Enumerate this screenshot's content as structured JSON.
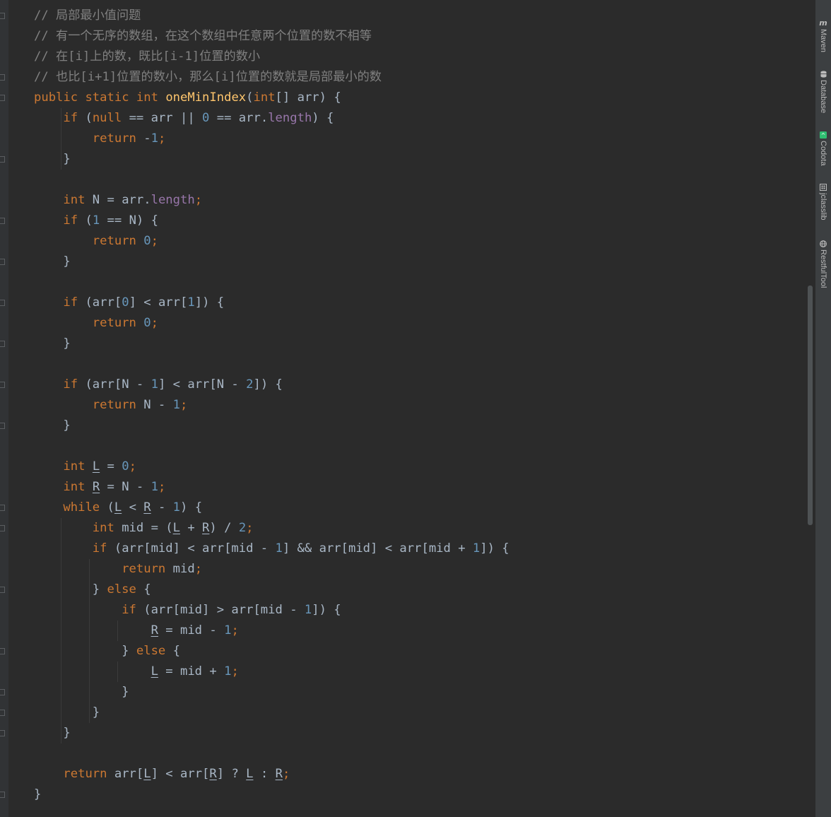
{
  "code_lines": [
    "// 局部最小值问题",
    "// 有一个无序的数组，在这个数组中任意两个位置的数不相等",
    "// 在[i]上的数，既比[i-1]位置的数小",
    "// 也比[i+1]位置的数小，那么[i]位置的数就是局部最小的数",
    "public static int oneMinIndex(int[] arr) {",
    "    if (null == arr || 0 == arr.length) {",
    "        return -1;",
    "    }",
    "",
    "    int N = arr.length;",
    "    if (1 == N) {",
    "        return 0;",
    "    }",
    "",
    "    if (arr[0] < arr[1]) {",
    "        return 0;",
    "    }",
    "",
    "    if (arr[N - 1] < arr[N - 2]) {",
    "        return N - 1;",
    "    }",
    "",
    "    int L = 0;",
    "    int R = N - 1;",
    "    while (L < R - 1) {",
    "        int mid = (L + R) / 2;",
    "        if (arr[mid] < arr[mid - 1] && arr[mid] < arr[mid + 1]) {",
    "            return mid;",
    "        } else {",
    "            if (arr[mid] > arr[mid - 1]) {",
    "                R = mid - 1;",
    "            } else {",
    "                L = mid + 1;",
    "            }",
    "        }",
    "    }",
    "",
    "    return arr[L] < arr[R] ? L : R;",
    "}"
  ],
  "side_tools": [
    {
      "label": "Maven",
      "icon": "m-icon"
    },
    {
      "label": "Database",
      "icon": "database-icon"
    },
    {
      "label": "Codota",
      "icon": "codota-icon"
    },
    {
      "label": "jclasslib",
      "icon": "jclasslib-icon"
    },
    {
      "label": "RestfulTool",
      "icon": "globe-icon"
    }
  ],
  "colors": {
    "background": "#2b2b2b",
    "text": "#a9b7c6",
    "comment": "#808080",
    "keyword": "#cc7832",
    "number": "#6897bb",
    "method_name": "#ffc66d",
    "field": "#9876aa"
  }
}
